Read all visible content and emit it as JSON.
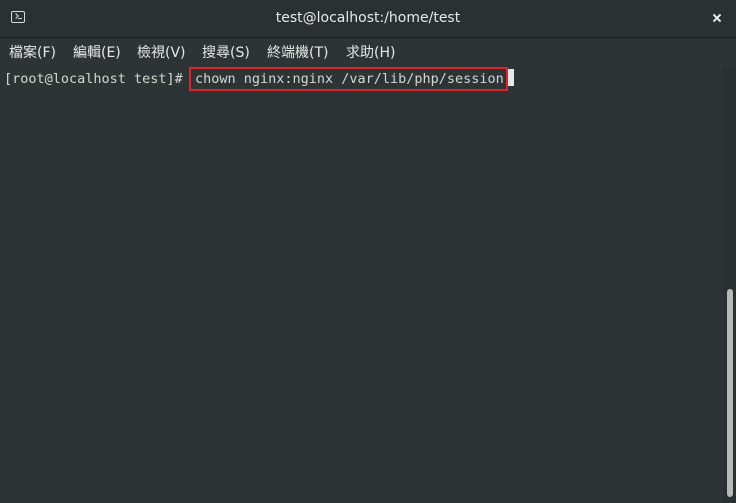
{
  "window": {
    "title": "test@localhost:/home/test",
    "icon": "terminal-icon",
    "close_icon": "close-icon"
  },
  "menu": [
    {
      "label": "檔案(F)"
    },
    {
      "label": "編輯(E)"
    },
    {
      "label": "檢視(V)"
    },
    {
      "label": "搜尋(S)"
    },
    {
      "label": "終端機(T)"
    },
    {
      "label": "求助(H)"
    }
  ],
  "terminal": {
    "prompt": "[root@localhost test]# ",
    "command": "chown nginx:nginx /var/lib/php/session",
    "highlight_color": "#e0242b"
  }
}
